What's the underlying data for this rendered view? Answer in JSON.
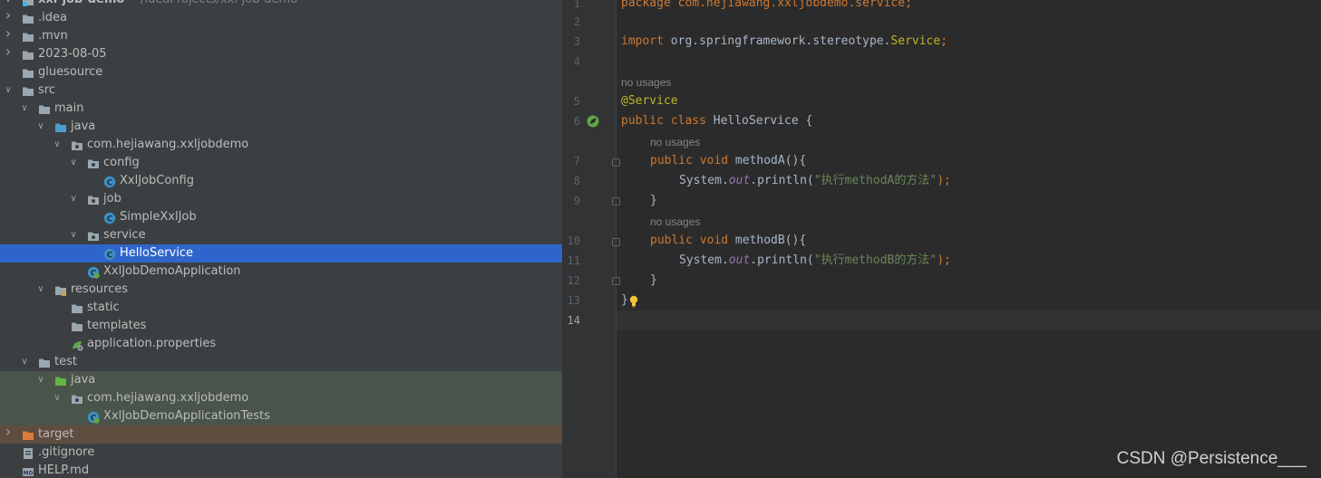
{
  "project": {
    "name": "xxl-job-demo",
    "path": "~/IdeaProjects/xxl-job-demo"
  },
  "tree": [
    {
      "label": "xxl-job-demo",
      "path_hint": "~/IdeaProjects/xxl-job-demo",
      "icon": "module-folder-icon",
      "depth": 0,
      "expanded": true
    },
    {
      "label": ".idea",
      "icon": "folder-icon",
      "depth": 0,
      "expanded": false
    },
    {
      "label": ".mvn",
      "icon": "folder-icon",
      "depth": 0,
      "expanded": false
    },
    {
      "label": "2023-08-05",
      "icon": "folder-icon",
      "depth": 0,
      "expanded": false
    },
    {
      "label": "gluesource",
      "icon": "folder-icon",
      "depth": 0
    },
    {
      "label": "src",
      "icon": "folder-icon",
      "depth": 0,
      "expanded": true
    },
    {
      "label": "main",
      "icon": "folder-icon",
      "depth": 1,
      "expanded": true
    },
    {
      "label": "java",
      "icon": "source-folder-icon",
      "depth": 2,
      "expanded": true
    },
    {
      "label": "com.hejiawang.xxljobdemo",
      "icon": "package-icon",
      "depth": 3,
      "expanded": true
    },
    {
      "label": "config",
      "icon": "package-icon",
      "depth": 4,
      "expanded": true
    },
    {
      "label": "XxlJobConfig",
      "icon": "class-icon",
      "depth": 5
    },
    {
      "label": "job",
      "icon": "package-icon",
      "depth": 4,
      "expanded": true
    },
    {
      "label": "SimpleXxlJob",
      "icon": "class-icon",
      "depth": 5
    },
    {
      "label": "service",
      "icon": "package-icon",
      "depth": 4,
      "expanded": true
    },
    {
      "label": "HelloService",
      "icon": "class-icon",
      "depth": 5,
      "selected": true
    },
    {
      "label": "XxlJobDemoApplication",
      "icon": "spring-boot-class-icon",
      "depth": 4
    },
    {
      "label": "resources",
      "icon": "resources-folder-icon",
      "depth": 2,
      "expanded": true
    },
    {
      "label": "static",
      "icon": "folder-icon",
      "depth": 3
    },
    {
      "label": "templates",
      "icon": "folder-icon",
      "depth": 3
    },
    {
      "label": "application.properties",
      "icon": "spring-properties-icon",
      "depth": 3
    },
    {
      "label": "test",
      "icon": "folder-icon",
      "depth": 1,
      "expanded": true
    },
    {
      "label": "java",
      "icon": "test-source-folder-icon",
      "depth": 2,
      "expanded": true,
      "test": true
    },
    {
      "label": "com.hejiawang.xxljobdemo",
      "icon": "package-icon",
      "depth": 3,
      "expanded": true,
      "test": true
    },
    {
      "label": "XxlJobDemoApplicationTests",
      "icon": "spring-boot-class-icon",
      "depth": 4,
      "test": true
    },
    {
      "label": "target",
      "icon": "excluded-folder-icon",
      "depth": 0,
      "expanded": false,
      "target": true
    },
    {
      "label": ".gitignore",
      "icon": "gitignore-file-icon",
      "depth": 0
    },
    {
      "label": "HELP.md",
      "icon": "markdown-file-icon",
      "depth": 0
    }
  ],
  "editor": {
    "line_numbers": [
      "1",
      "2",
      "3",
      "4",
      "5",
      "6",
      "7",
      "8",
      "9",
      "10",
      "11",
      "12",
      "13",
      "14"
    ],
    "current_line": "14",
    "hint_text": "no usages",
    "code": {
      "l1_kw": "package",
      "l1_rest": " com.hejiawang.xxljobdemo.service;",
      "l3_kw": "import",
      "l3_pkg": " org.springframework.stereotype.",
      "l3_cls": "Service",
      "l3_end": ";",
      "l5_ann": "@Service",
      "l6_kw": "public class",
      "l6_name": " HelloService {",
      "l7_kw": "public void",
      "l7_name": " methodA(){",
      "sys": "System.",
      "out": "out",
      "println": ".println(",
      "strA": "\"执行methodA的方法\"",
      "close_call": ");",
      "brace_close": "}",
      "l10_kw": "public void",
      "l10_name": " methodB(){",
      "strB": "\"执行methodB的方法\"",
      "class_close": "}"
    }
  },
  "watermark": "CSDN @Persistence___",
  "colors": {
    "keyword": "#cc7832",
    "annotation": "#bbb529",
    "string": "#6a8759",
    "field": "#9876aa",
    "selection": "#2f65ca"
  }
}
